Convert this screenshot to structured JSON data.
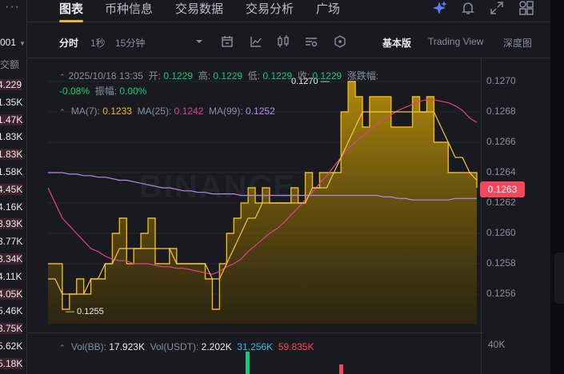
{
  "left_panel": {
    "dots": "···",
    "pair_fragment": "001",
    "volume_header": "成交额",
    "volume_rows": [
      "4.229",
      "1.35K",
      "1.47K",
      "1.83K",
      "1.83K",
      "1.58K",
      "4.45K",
      "4.16K",
      "3.93K",
      "3.77K",
      "3.34K",
      "4.11K",
      "4.05K",
      "5.46K",
      "3.75K",
      "5.62K",
      "5.18K"
    ],
    "row_colors": [
      "#f6465d",
      "#0ecb81"
    ]
  },
  "nav": {
    "tabs": [
      {
        "label": "图表",
        "active": true
      },
      {
        "label": "币种信息",
        "active": false
      },
      {
        "label": "交易数据",
        "active": false
      },
      {
        "label": "交易分析",
        "active": false
      },
      {
        "label": "广场",
        "active": false
      }
    ],
    "icons": [
      "sparkle-icon",
      "bell-icon",
      "expand-icon",
      "grid-icon"
    ]
  },
  "toolbar": {
    "intervals": [
      "分时",
      "1秒",
      "15分钟"
    ],
    "active_interval": "分时",
    "views": [
      "基本版",
      "Trading View",
      "深度图"
    ],
    "active_view": "基本版",
    "icons": [
      "chevron-down-icon",
      "calendar-icon",
      "indicator-icon",
      "candle-icon",
      "settings-icon",
      "hexagon-icon"
    ]
  },
  "ohlc": {
    "date": "2025/10/18 13:35",
    "open_label": "开:",
    "open": "0.1229",
    "high_label": "高:",
    "high": "0.1229",
    "low_label": "低:",
    "low": "0.1229",
    "close_label": "收:",
    "close": "0.1229",
    "change_label": "涨跌幅:",
    "change": "-0.08%",
    "amplitude_label": "振幅:",
    "amplitude": "0.00%"
  },
  "ma": {
    "ma7_label": "MA(7):",
    "ma7": "0.1233",
    "ma25_label": "MA(25):",
    "ma25": "0.1242",
    "ma99_label": "MA(99):",
    "ma99": "0.1252"
  },
  "price_axis": [
    "0.1270",
    "0.1268",
    "0.1266",
    "0.1264",
    "0.1262",
    "0.1260",
    "0.1258",
    "0.1256"
  ],
  "current_price": "0.1263",
  "high_marker": "0.1270",
  "low_marker": "0.1255",
  "watermark": "BINANCE",
  "volume": {
    "label": "Vol(BB):",
    "bb": "17.923K",
    "usdt_label": "Vol(USDT):",
    "usdt": "2.202K",
    "ma1": "31.256K",
    "ma2": "59.835K",
    "axis_top": "40K"
  },
  "colors": {
    "accent": "#f0b90b",
    "up": "#0ecb81",
    "down": "#f6465d",
    "ma25": "#e53e8e",
    "ma99": "#b18bf0"
  },
  "chart_data": {
    "type": "area",
    "ylim": [
      0.1254,
      0.1271
    ],
    "price": [
      0.1258,
      0.1258,
      0.1255,
      0.1256,
      0.1257,
      0.1256,
      0.1257,
      0.1257,
      0.1258,
      0.126,
      0.1261,
      0.1258,
      0.1259,
      0.126,
      0.1261,
      0.1258,
      0.1258,
      0.1259,
      0.1258,
      0.1258,
      0.1258,
      0.1258,
      0.1257,
      0.1255,
      0.1258,
      0.126,
      0.1261,
      0.1262,
      0.1263,
      0.1262,
      0.1263,
      0.1262,
      0.1262,
      0.1262,
      0.1263,
      0.1262,
      0.1264,
      0.1263,
      0.1264,
      0.1264,
      0.1264,
      0.1268,
      0.127,
      0.1269,
      0.1267,
      0.1269,
      0.1269,
      0.1269,
      0.1267,
      0.1267,
      0.1267,
      0.1269,
      0.1268,
      0.1269,
      0.1266,
      0.1266,
      0.1264,
      0.1264,
      0.1264,
      0.1264,
      0.1263
    ],
    "ma7": [
      0.1257,
      0.1257,
      0.1256,
      0.1256,
      0.1256,
      0.1256,
      0.1257,
      0.1257,
      0.1258,
      0.1258,
      0.1259,
      0.1259,
      0.1259,
      0.1259,
      0.1259,
      0.1259,
      0.1259,
      0.1259,
      0.1258,
      0.1258,
      0.1258,
      0.1258,
      0.1258,
      0.1257,
      0.1257,
      0.1258,
      0.1259,
      0.126,
      0.1261,
      0.1261,
      0.1262,
      0.1262,
      0.1262,
      0.1262,
      0.1262,
      0.1262,
      0.1262,
      0.1263,
      0.1263,
      0.1263,
      0.1264,
      0.1265,
      0.1266,
      0.1267,
      0.1268,
      0.1268,
      0.1268,
      0.1268,
      0.1268,
      0.1268,
      0.1268,
      0.1268,
      0.1268,
      0.1268,
      0.1268,
      0.1267,
      0.1266,
      0.1265,
      0.1265,
      0.1264,
      0.12635
    ],
    "ma25": [
      0.1263,
      0.1262,
      0.1261,
      0.12605,
      0.126,
      0.12595,
      0.1259,
      0.12588,
      0.12585,
      0.12583,
      0.12582,
      0.12582,
      0.1258,
      0.1258,
      0.1258,
      0.12579,
      0.12578,
      0.12578,
      0.12577,
      0.12577,
      0.12576,
      0.12575,
      0.12574,
      0.12573,
      0.12575,
      0.12578,
      0.1258,
      0.12583,
      0.12588,
      0.12592,
      0.12596,
      0.126,
      0.12603,
      0.12607,
      0.12612,
      0.12617,
      0.12622,
      0.12627,
      0.12633,
      0.12638,
      0.12644,
      0.1265,
      0.12656,
      0.1266,
      0.12664,
      0.12668,
      0.12672,
      0.12675,
      0.12678,
      0.12681,
      0.12683,
      0.12685,
      0.12687,
      0.12688,
      0.12688,
      0.12687,
      0.12686,
      0.12684,
      0.12681,
      0.12676,
      0.12673
    ],
    "ma99": [
      0.1264,
      0.1264,
      0.1264,
      0.12639,
      0.12639,
      0.12638,
      0.12638,
      0.12637,
      0.12637,
      0.12636,
      0.12635,
      0.12635,
      0.12634,
      0.12633,
      0.12632,
      0.12631,
      0.1263,
      0.1263,
      0.12629,
      0.12628,
      0.12628,
      0.12627,
      0.12627,
      0.12626,
      0.12626,
      0.12626,
      0.12626,
      0.12625,
      0.12625,
      0.12625,
      0.12625,
      0.12625,
      0.12625,
      0.12625,
      0.12625,
      0.12625,
      0.12625,
      0.12625,
      0.12625,
      0.12625,
      0.12625,
      0.12625,
      0.12625,
      0.12625,
      0.12625,
      0.12625,
      0.12625,
      0.12624,
      0.12624,
      0.12623,
      0.12623,
      0.12622,
      0.12622,
      0.12622,
      0.12622,
      0.12622,
      0.12622,
      0.12623,
      0.12623,
      0.12623,
      0.12623
    ]
  }
}
